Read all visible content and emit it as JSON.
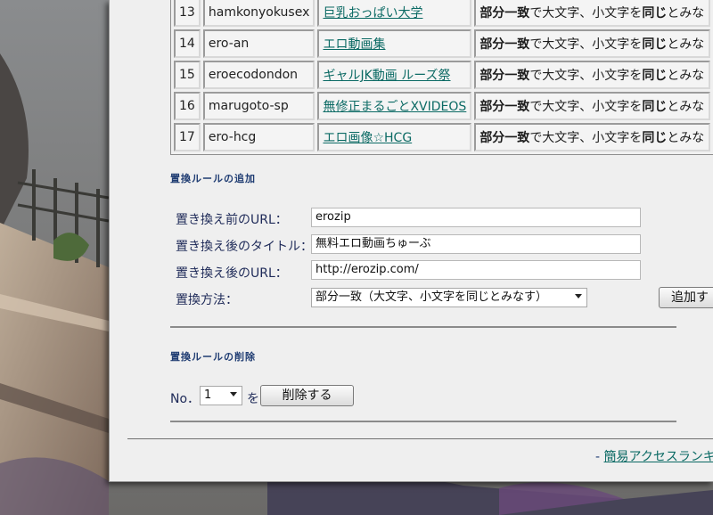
{
  "rules": [
    {
      "no": "13",
      "key": "hamkonyokusex",
      "title": "巨乳おっぱい大学",
      "method_bold": "部分一致",
      "method_text": "で大文字、小文字を",
      "method_bold2": "同じ",
      "method_text2": "とみな"
    },
    {
      "no": "14",
      "key": "ero-an",
      "title": "エロ動画集",
      "method_bold": "部分一致",
      "method_text": "で大文字、小文字を",
      "method_bold2": "同じ",
      "method_text2": "とみな"
    },
    {
      "no": "15",
      "key": "eroecodondon",
      "title": "ギャルJK動画 ルーズ祭",
      "method_bold": "部分一致",
      "method_text": "で大文字、小文字を",
      "method_bold2": "同じ",
      "method_text2": "とみな"
    },
    {
      "no": "16",
      "key": "marugoto-sp",
      "title": "無修正まるごとXVIDEOS",
      "method_bold": "部分一致",
      "method_text": "で大文字、小文字を",
      "method_bold2": "同じ",
      "method_text2": "とみな"
    },
    {
      "no": "17",
      "key": "ero-hcg",
      "title": "エロ画像☆HCG",
      "method_bold": "部分一致",
      "method_text": "で大文字、小文字を",
      "method_bold2": "同じ",
      "method_text2": "とみな"
    }
  ],
  "add_section": {
    "title": "置換ルールの追加",
    "before_url_label": "置き換え前のURL：",
    "before_url_value": "erozip",
    "after_title_label": "置き換え後のタイトル：",
    "after_title_value": "無料エロ動画ちゅーぶ",
    "after_url_label": "置き換え後のURL：",
    "after_url_value": "http://erozip.com/",
    "method_label": "置換方法：",
    "method_value": "部分一致（大文字、小文字を同じとみなす）",
    "add_button": "追加す"
  },
  "delete_section": {
    "title": "置換ルールの削除",
    "no_label": "No．",
    "no_value": "1",
    "particle": "を",
    "delete_button": "削除する"
  },
  "footer": {
    "dash": "- ",
    "link": "簡易アクセスランキ"
  },
  "colors": {
    "link": "#0b6a64",
    "heading": "#1f3c72",
    "window_bg": "#efefef"
  }
}
